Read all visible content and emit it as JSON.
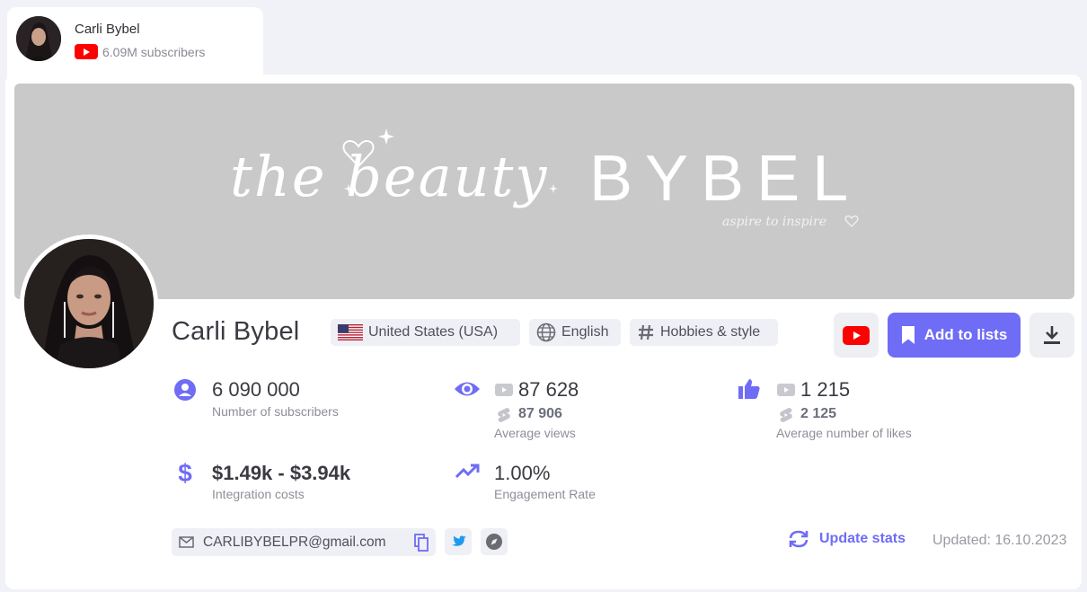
{
  "tab": {
    "name": "Carli Bybel",
    "subscribers": "6.09M subscribers",
    "platform_icon": "youtube-icon"
  },
  "banner": {
    "script_text": "the beauty",
    "brand_text": "BYBEL",
    "tagline": "aspire to inspire",
    "background": "#c9c9c9"
  },
  "profile": {
    "name": "Carli Bybel",
    "country": "United States (USA)",
    "language": "English",
    "category": "Hobbies & style"
  },
  "actions": {
    "add_to_lists": "Add to lists",
    "youtube_icon": "youtube-icon",
    "download_icon": "download-icon"
  },
  "stats": {
    "subscribers": {
      "value": "6 090 000",
      "label": "Number of subscribers"
    },
    "views": {
      "value": "87 628",
      "shorts_value": "87 906",
      "label": "Average views"
    },
    "likes": {
      "value": "1 215",
      "shorts_value": "2 125",
      "label": "Average number of likes"
    },
    "costs": {
      "value": "$1.49k - $3.94k",
      "label": "Integration costs"
    },
    "engagement": {
      "value": "1.00%",
      "label": "Engagement Rate"
    }
  },
  "contact": {
    "email": "CARLIBYBELPR@gmail.com",
    "socials": [
      "twitter-icon",
      "compass-icon"
    ]
  },
  "footer": {
    "update_label": "Update stats",
    "updated": "Updated: 16.10.2023"
  },
  "colors": {
    "accent": "#6f6cf6",
    "youtube": "#ff0000",
    "chip_bg": "#eff0f5",
    "page_bg": "#f1f2f7"
  }
}
